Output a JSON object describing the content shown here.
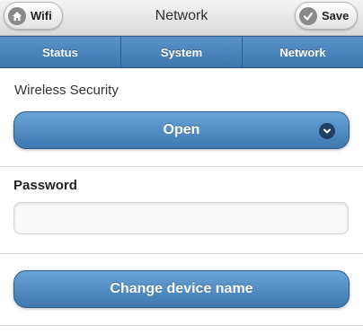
{
  "header": {
    "back_label": "Wifi",
    "title": "Network",
    "save_label": "Save",
    "back_icon": "home-icon",
    "save_icon": "check-icon"
  },
  "tabs": [
    {
      "label": "Status"
    },
    {
      "label": "System"
    },
    {
      "label": "Network"
    }
  ],
  "security": {
    "label": "Wireless Security",
    "selected": "Open",
    "icon": "chevron-down-icon"
  },
  "password": {
    "label": "Password",
    "value": "",
    "placeholder": ""
  },
  "actions": {
    "change_name_label": "Change device name"
  },
  "colors": {
    "accent": "#4a85bd",
    "tab": "#4f88bf",
    "header_bg": "#e6e6e6"
  }
}
